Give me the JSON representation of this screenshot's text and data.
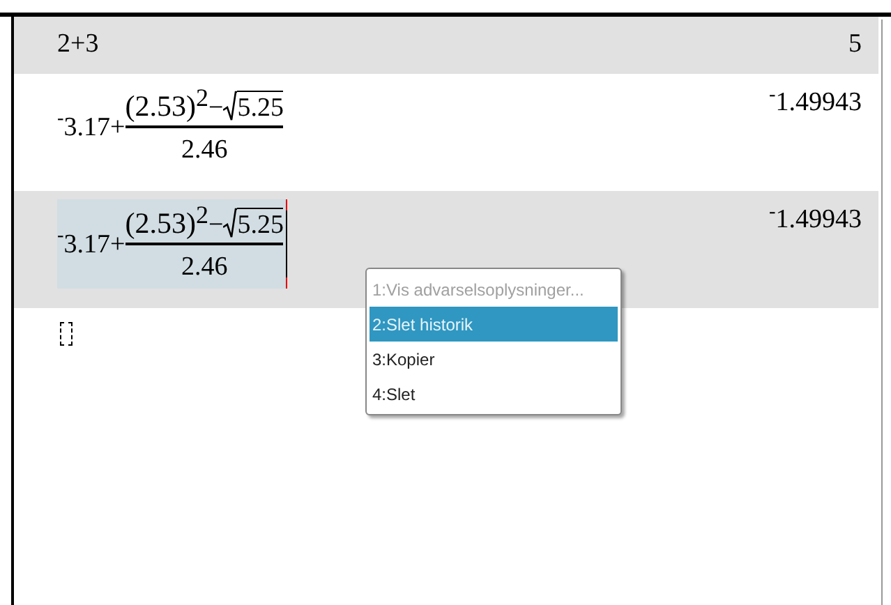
{
  "entries": [
    {
      "kind": "plain",
      "expression": "2+3",
      "result": "5",
      "selected": false
    },
    {
      "kind": "fraction",
      "prefix": "$^{-}$3.17+",
      "base": "(2.53)",
      "exponent": "2",
      "operator": "−",
      "radicand": "5.25",
      "denominator": "2.46",
      "result": "$^{-}$1.49943",
      "selected": false
    },
    {
      "kind": "fraction",
      "prefix": "$^{-}$3.17+",
      "base": "(2.53)",
      "exponent": "2",
      "operator": "−",
      "radicand": "5.25",
      "denominator": "2.46",
      "result": "$^{-}$1.49943",
      "selected": true
    }
  ],
  "context_menu": [
    {
      "label": "1:Vis advarselsoplysninger...",
      "disabled": true,
      "selected": false
    },
    {
      "label": "2:Slet historik",
      "disabled": false,
      "selected": true
    },
    {
      "label": "3:Kopier",
      "disabled": false,
      "selected": false
    },
    {
      "label": "4:Slet",
      "disabled": false,
      "selected": false
    }
  ]
}
